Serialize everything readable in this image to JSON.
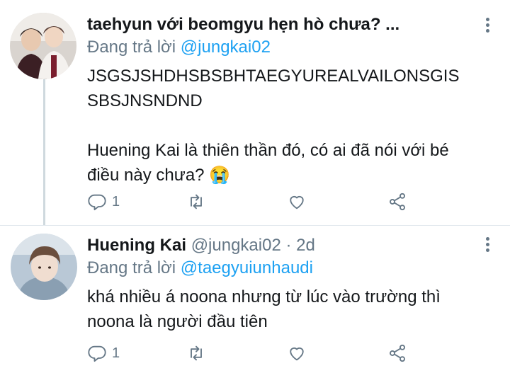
{
  "tweet1": {
    "display_name": "taehyun với beomgyu hẹn hò chưa? ...",
    "reply_prefix": "Đang trả lời",
    "reply_mention": "@jungkai02",
    "text": "JSGSJSHDHSBSBHTAEGYUREALVAILONSGIS\nSBSJNSNDND\n\nHuening Kai là thiên thần đó, có ai đã nói với bé điều này chưa? 😭",
    "reply_count": "1",
    "avatar_icon": "profile-photo-two-people"
  },
  "tweet2": {
    "display_name": "Huening Kai",
    "handle": "@jungkai02",
    "time": "· 2d",
    "reply_prefix": "Đang trả lời",
    "reply_mention": "@taegyuiunhaudi",
    "text": "khá nhiều á noona nhưng từ lúc vào trường thì noona là người đầu tiên",
    "reply_count": "1",
    "avatar_icon": "profile-photo-person"
  },
  "colors": {
    "text": "#14171a",
    "secondary": "#657786",
    "link": "#1da1f2",
    "divider": "#e1e8ed"
  }
}
